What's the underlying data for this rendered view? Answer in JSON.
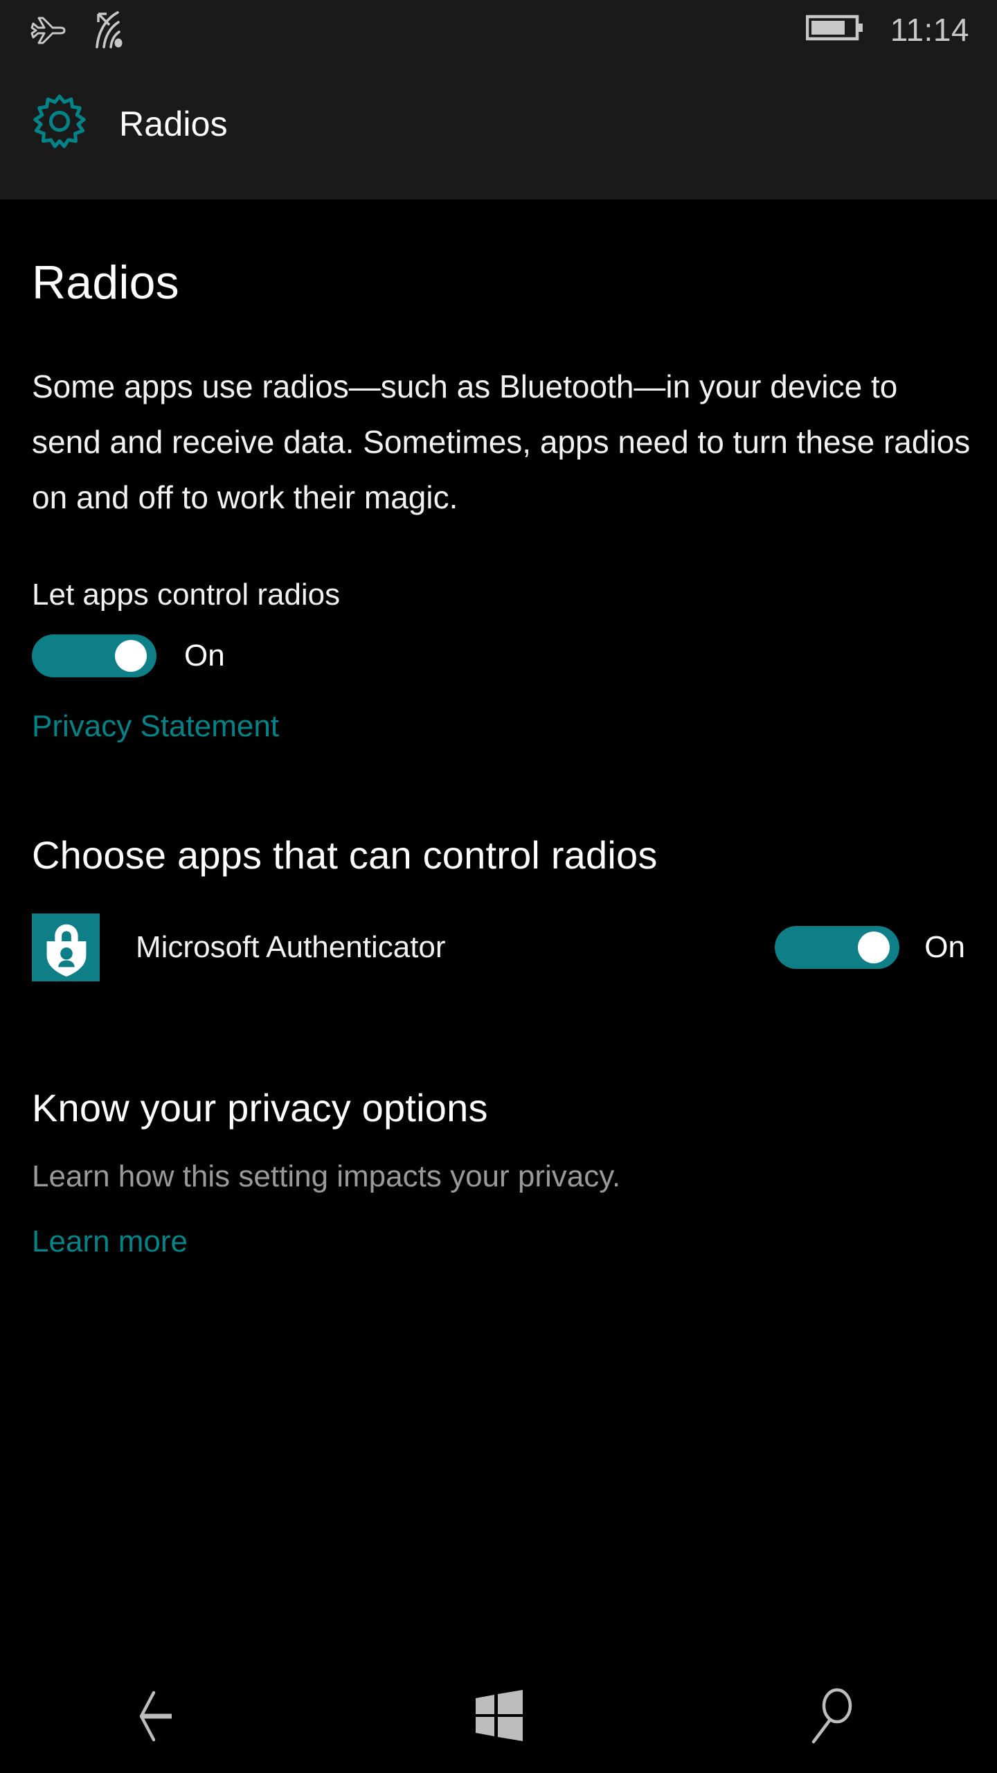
{
  "status_bar": {
    "airplane_icon": "airplane-mode-icon",
    "wifi_icon": "wifi-signal-icon",
    "battery_icon": "battery-icon",
    "battery_level_percent": 75,
    "time": "11:14"
  },
  "header": {
    "gear_icon": "gear-icon",
    "title": "Radios"
  },
  "page": {
    "title": "Radios",
    "description": "Some apps use radios—such as Bluetooth—in your device to send and receive data. Sometimes, apps need to turn these radios on and off to work their magic.",
    "setting_label": "Let apps control radios",
    "setting_state": "On",
    "privacy_statement_link": "Privacy Statement"
  },
  "apps_section": {
    "heading": "Choose apps that can control radios",
    "apps": [
      {
        "name": "Microsoft Authenticator",
        "icon": "authenticator-shield-lock-icon",
        "state": "On",
        "icon_bg": "#0e7f86"
      }
    ]
  },
  "privacy_section": {
    "heading": "Know your privacy options",
    "subtext": "Learn how this setting impacts your privacy.",
    "learn_more_link": "Learn more"
  },
  "nav_bar": {
    "back": "back-arrow-icon",
    "start": "windows-start-icon",
    "search": "search-icon"
  },
  "colors": {
    "accent_teal": "#0e7f86",
    "link_teal": "#038387",
    "header_bg": "#1a1a1a",
    "page_bg": "#000000",
    "text_primary": "#f2f2f2",
    "text_muted": "#9a9a9a",
    "nav_icon": "#bdbdbd"
  }
}
